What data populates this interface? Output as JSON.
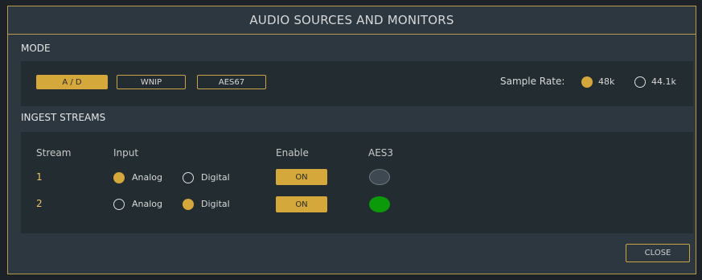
{
  "dialog": {
    "title": "AUDIO SOURCES AND MONITORS",
    "close_label": "CLOSE"
  },
  "mode": {
    "label": "MODE",
    "buttons": [
      "A / D",
      "WNIP",
      "AES67"
    ],
    "selected": "A / D",
    "sample_rate": {
      "label": "Sample Rate:",
      "options": [
        "48k",
        "44.1k"
      ],
      "selected": "48k"
    }
  },
  "ingest": {
    "label": "INGEST STREAMS",
    "headers": {
      "stream": "Stream",
      "input": "Input",
      "enable": "Enable",
      "aes3": "AES3"
    },
    "input_options": {
      "analog": "Analog",
      "digital": "Digital"
    },
    "rows": [
      {
        "stream": "1",
        "input": "Analog",
        "enable": "ON",
        "aes3_status": "inactive"
      },
      {
        "stream": "2",
        "input": "Digital",
        "enable": "ON",
        "aes3_status": "active"
      }
    ]
  },
  "colors": {
    "accent": "#d4a83a",
    "aes3_active": "#0a9a0a",
    "aes3_inactive": "#3d4850"
  }
}
